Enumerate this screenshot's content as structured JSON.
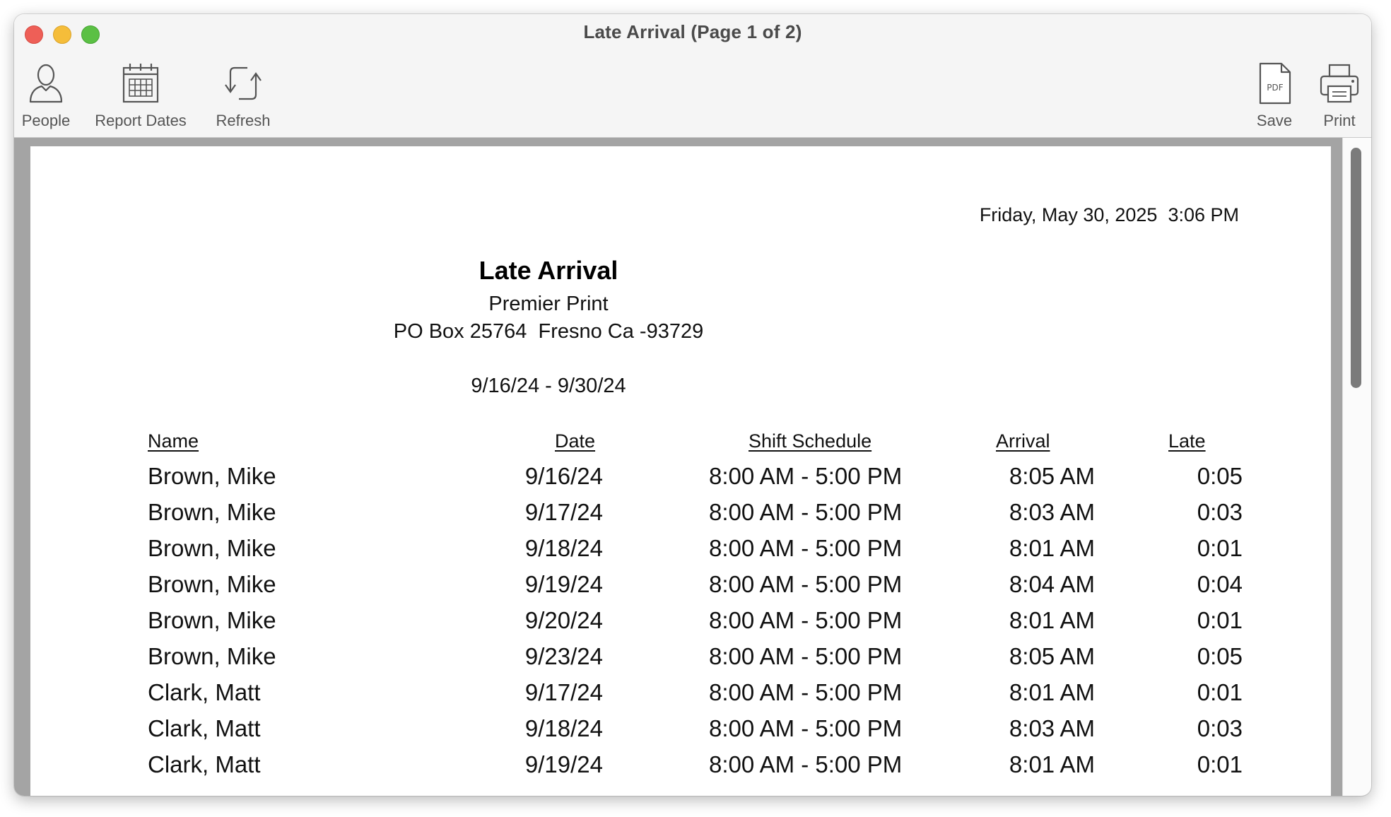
{
  "window": {
    "title": "Late Arrival  (Page 1 of 2)"
  },
  "toolbar": {
    "people_label": "People",
    "report_dates_label": "Report Dates",
    "refresh_label": "Refresh",
    "save_label": "Save",
    "save_icon_text": "PDF",
    "print_label": "Print"
  },
  "report": {
    "datetime": "Friday, May 30, 2025  3:06 PM",
    "title": "Late Arrival",
    "company": "Premier Print",
    "address": "PO Box 25764  Fresno Ca -93729",
    "date_range": "9/16/24 - 9/30/24",
    "columns": {
      "name": "Name",
      "date": "Date",
      "shift": "Shift Schedule",
      "arrival": "Arrival",
      "late": "Late"
    },
    "rows": [
      {
        "name": "Brown, Mike",
        "date": "9/16/24",
        "shift": "8:00 AM - 5:00 PM",
        "arrival": "8:05 AM",
        "late": "0:05"
      },
      {
        "name": "Brown, Mike",
        "date": "9/17/24",
        "shift": "8:00 AM - 5:00 PM",
        "arrival": "8:03 AM",
        "late": "0:03"
      },
      {
        "name": "Brown, Mike",
        "date": "9/18/24",
        "shift": "8:00 AM - 5:00 PM",
        "arrival": "8:01 AM",
        "late": "0:01"
      },
      {
        "name": "Brown, Mike",
        "date": "9/19/24",
        "shift": "8:00 AM - 5:00 PM",
        "arrival": "8:04 AM",
        "late": "0:04"
      },
      {
        "name": "Brown, Mike",
        "date": "9/20/24",
        "shift": "8:00 AM - 5:00 PM",
        "arrival": "8:01 AM",
        "late": "0:01"
      },
      {
        "name": "Brown, Mike",
        "date": "9/23/24",
        "shift": "8:00 AM - 5:00 PM",
        "arrival": "8:05 AM",
        "late": "0:05"
      },
      {
        "name": "Clark, Matt",
        "date": "9/17/24",
        "shift": "8:00 AM - 5:00 PM",
        "arrival": "8:01 AM",
        "late": "0:01"
      },
      {
        "name": "Clark, Matt",
        "date": "9/18/24",
        "shift": "8:00 AM - 5:00 PM",
        "arrival": "8:03 AM",
        "late": "0:03"
      },
      {
        "name": "Clark, Matt",
        "date": "9/19/24",
        "shift": "8:00 AM - 5:00 PM",
        "arrival": "8:01 AM",
        "late": "0:01"
      }
    ]
  }
}
